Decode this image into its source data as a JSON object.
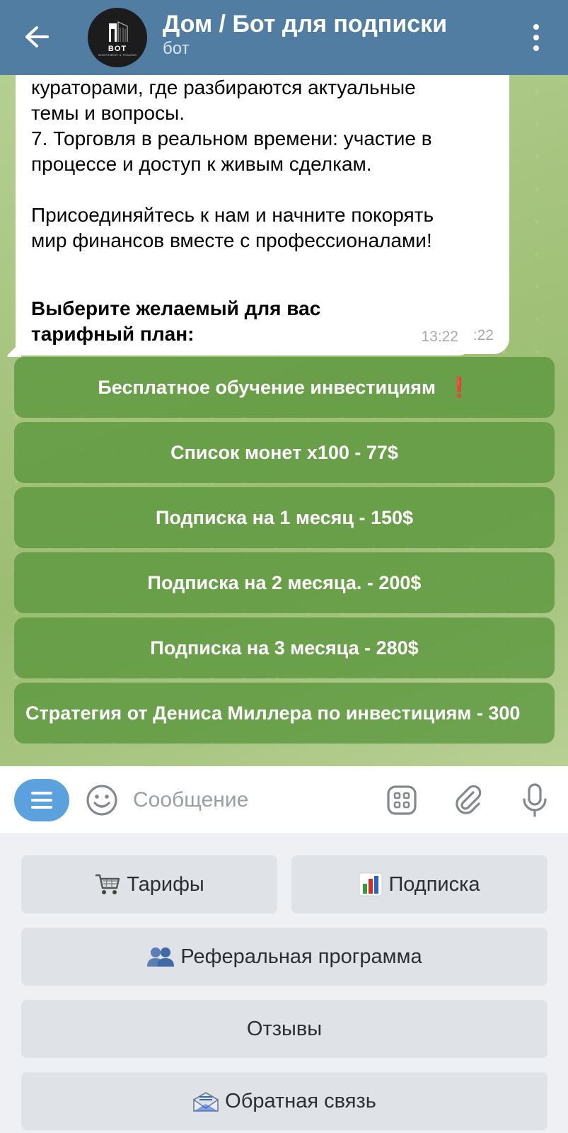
{
  "header": {
    "title": "Дом / Бот для подписки",
    "subtitle": "бот",
    "avatar_text": "BOT",
    "avatar_subtext": "INVESTMENT & TRADING"
  },
  "messages": [
    {
      "lines": [
        "кураторами, где разбираются актуальные",
        "темы и вопросы.",
        "7. Торговля в реальном времени: участие в",
        "процессе и доступ к живым сделкам.",
        "",
        "Присоединяйтесь к нам и начните покорять",
        "мир финансов вместе с профессионалами!"
      ],
      "time": "13:22"
    },
    {
      "text": "Выберите желаемый для вас тарифный план:",
      "time": "13:22"
    }
  ],
  "inline_buttons": [
    {
      "label": "Бесплатное обучение инвестициям",
      "badge": "❗"
    },
    {
      "label": "Список монет х100 - 77$"
    },
    {
      "label": "Подписка на 1 месяц - 150$"
    },
    {
      "label": "Подписка на 2 месяца. - 200$"
    },
    {
      "label": "Подписка на 3 месяца - 280$"
    },
    {
      "label": "Стратегия от Дениса Миллера по инвестициям - 300"
    }
  ],
  "input": {
    "placeholder": "Сообщение",
    "icons": [
      "menu-icon",
      "emoji-icon",
      "sticker-icon",
      "attach-icon",
      "microphone-icon"
    ]
  },
  "keyboard": {
    "buttons": [
      {
        "label": "Тарифы",
        "icon": "shopping-cart-icon"
      },
      {
        "label": "Подписка",
        "icon": "bar-chart-icon"
      },
      {
        "label": "Реферальная программа",
        "icon": "people-icon"
      },
      {
        "label": "Отзывы"
      },
      {
        "label": "Обратная связь",
        "icon": "incoming-envelope-icon"
      }
    ]
  },
  "colors": {
    "header": "#517da2",
    "inline_button": "#5a963c",
    "bot_menu": "#5aa1dd",
    "keyboard_button": "#dfe3e7"
  }
}
